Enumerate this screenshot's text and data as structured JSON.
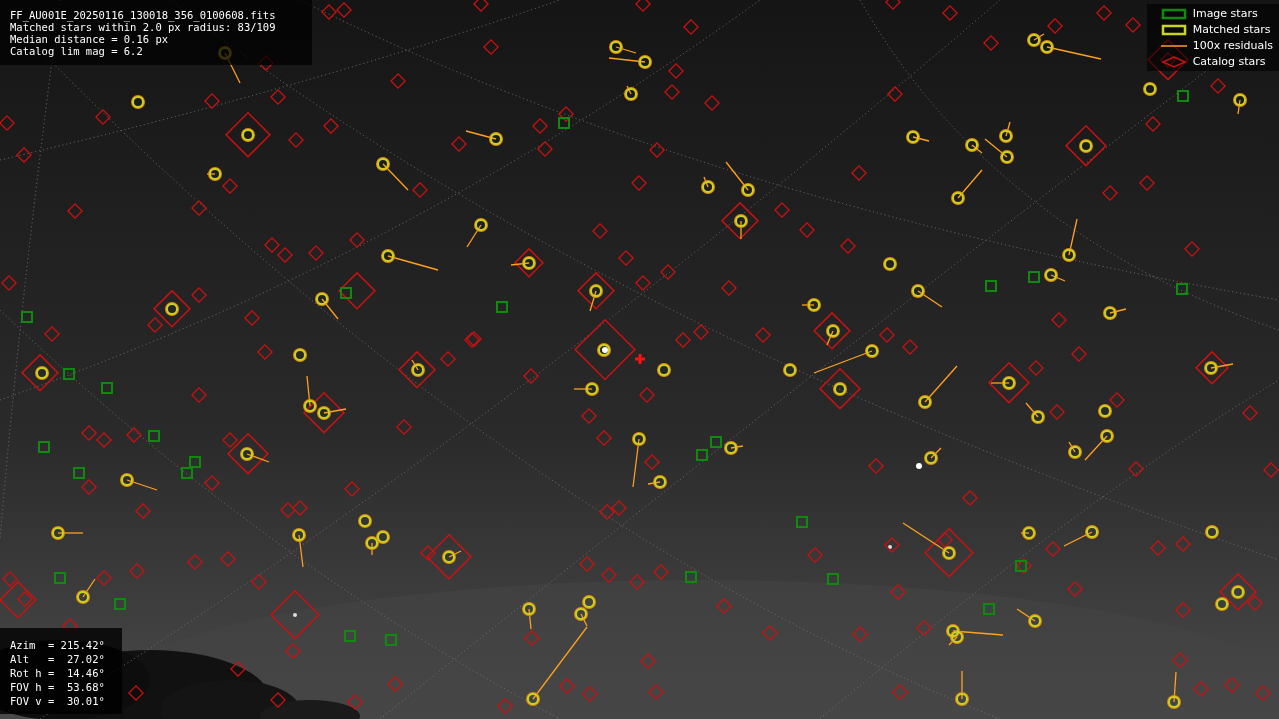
{
  "info": {
    "lines": [
      "FF_AU001E_20250116_130018_356_0100608.fits",
      "Matched stars within 2.0 px radius: 83/109",
      "Median distance = 0.16 px",
      "Catalog lim mag = 6.2"
    ]
  },
  "legend": [
    {
      "label": "Image stars"
    },
    {
      "kind": "matched",
      "label": "Matched stars"
    },
    {
      "kind": "residual",
      "label": "100x residuals"
    },
    {
      "kind": "catalog",
      "label": "Catalog stars"
    }
  ],
  "pointing": {
    "lines": [
      "Azim  = 215.42°",
      "Alt   =  27.02°",
      "Rot h =  14.46°",
      "FOV h =  53.68°",
      "FOV v =  30.01°"
    ]
  }
}
